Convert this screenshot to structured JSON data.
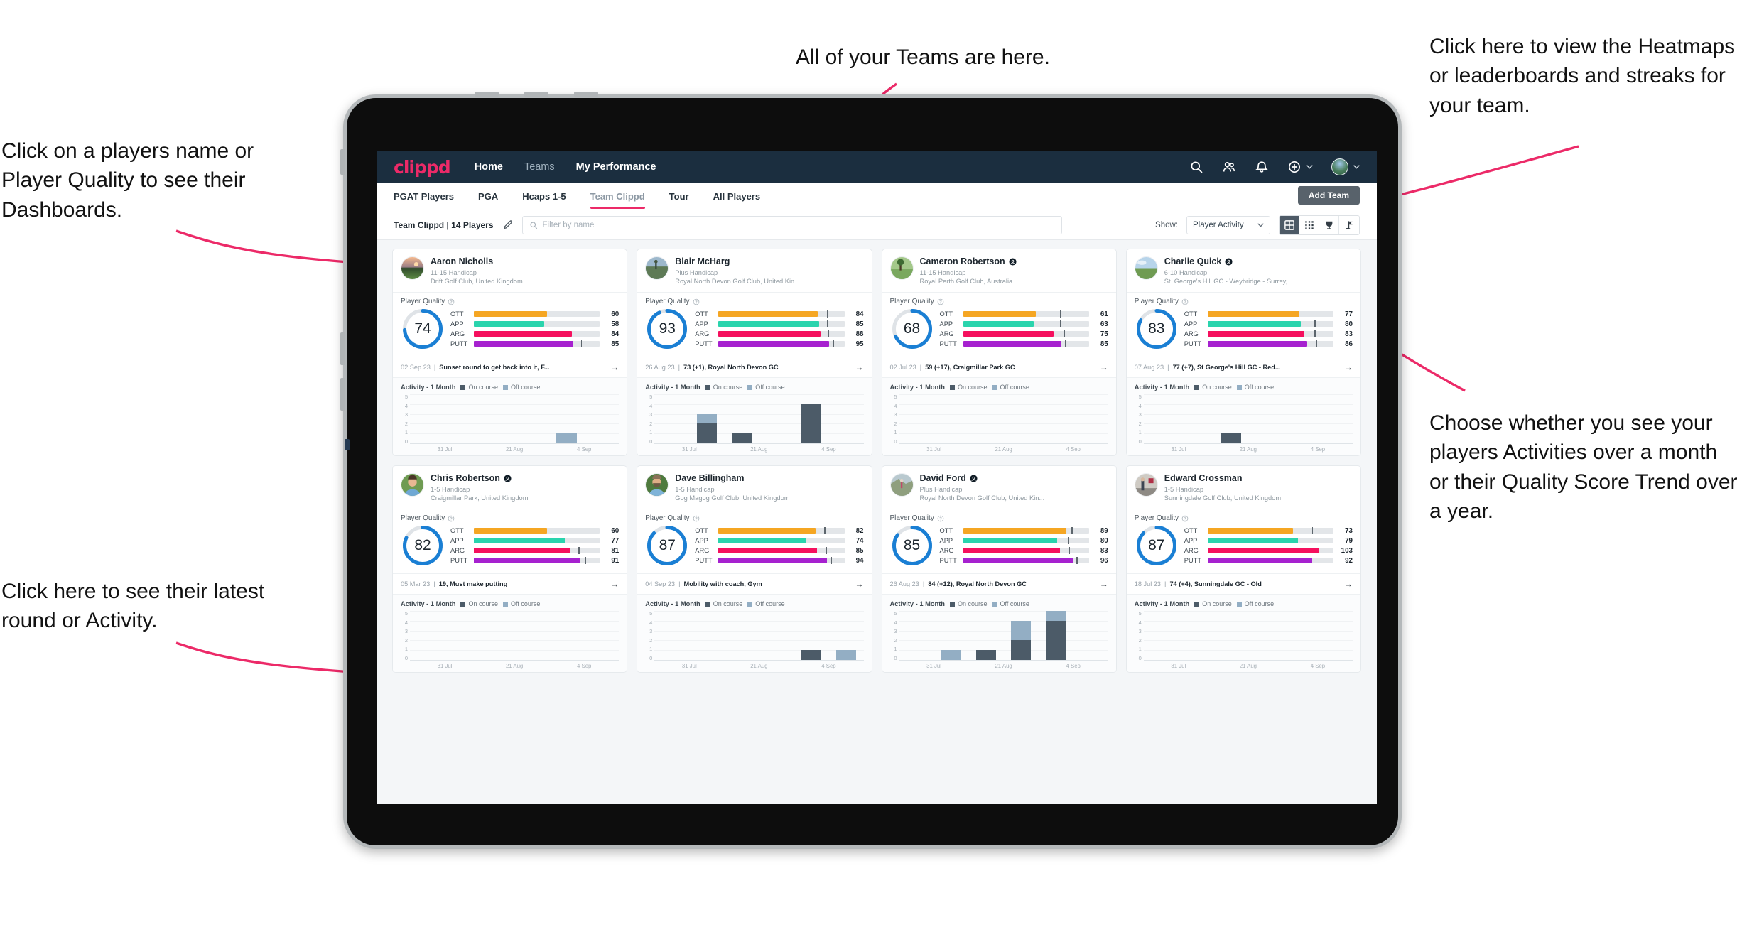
{
  "annotations": {
    "top_left": "Click on a players name or Player Quality to see their Dashboards.",
    "bottom_left": "Click here to see their latest round or Activity.",
    "top_center": "All of your Teams are here.",
    "top_right": "Click here to view the Heatmaps or leaderboards and streaks for your team.",
    "right": "Choose whether you see your players Activities over a month or their Quality Score Trend over a year.",
    "color": "#ec2a68"
  },
  "appbar": {
    "brand": "clippd",
    "nav": [
      {
        "label": "Home",
        "active": true
      },
      {
        "label": "Teams",
        "active": false
      },
      {
        "label": "My Performance",
        "active": true
      }
    ],
    "icons": [
      "search-icon",
      "people-icon",
      "bell-icon",
      "plus-circle-icon",
      "avatar"
    ]
  },
  "tabs": [
    {
      "label": "PGAT Players",
      "active": false
    },
    {
      "label": "PGA",
      "active": false
    },
    {
      "label": "Hcaps 1-5",
      "active": false
    },
    {
      "label": "Team Clippd",
      "active": true
    },
    {
      "label": "Tour",
      "active": false
    },
    {
      "label": "All Players",
      "active": false
    }
  ],
  "add_team_label": "Add Team",
  "toolbar": {
    "team_label": "Team Clippd | 14 Players",
    "edit_icon": "pencil-icon",
    "search_placeholder": "Filter by name",
    "search_value": "",
    "show_label": "Show:",
    "show_value": "Player Activity",
    "show_options": [
      "Player Activity",
      "Quality Score Trend"
    ],
    "views": [
      {
        "name": "card-view",
        "icon": "grid-large-icon",
        "active": true
      },
      {
        "name": "table-view",
        "icon": "grid-small-icon",
        "active": false
      },
      {
        "name": "leaderboard-view",
        "icon": "trophy-icon",
        "active": false
      },
      {
        "name": "heatmap-view",
        "icon": "flag-icon",
        "active": false
      }
    ]
  },
  "card_labels": {
    "player_quality": "Player Quality",
    "activity": "Activity - 1 Month",
    "legend_on": "On course",
    "legend_off": "Off course",
    "metrics": [
      "OTT",
      "APP",
      "ARG",
      "PUTT"
    ],
    "x_ticks": [
      "31 Jul",
      "21 Aug",
      "4 Sep"
    ],
    "y_ticks": [
      "5",
      "4",
      "3",
      "2",
      "1",
      "0"
    ]
  },
  "colors": {
    "ott": "#f5a623",
    "app": "#2ad4ad",
    "arg": "#f5105e",
    "putt": "#a621cf",
    "ring": "#1a7fd4",
    "ring_track": "#dfe3e7",
    "on_course": "#4c5b68",
    "off_course": "#93aec4",
    "brand": "#ec2a68",
    "header": "#1b2e3f"
  },
  "players": [
    {
      "name": "Aaron Nicholls",
      "verified": false,
      "handicap": "11-15 Handicap",
      "club": "Drift Golf Club, United Kingdom",
      "quality": 74,
      "metrics": [
        {
          "label": "OTT",
          "value": 60,
          "fill": 58,
          "tick": 76
        },
        {
          "label": "APP",
          "value": 58,
          "fill": 56,
          "tick": 76
        },
        {
          "label": "ARG",
          "value": 84,
          "fill": 78,
          "tick": 84
        },
        {
          "label": "PUTT",
          "value": 85,
          "fill": 79,
          "tick": 85
        }
      ],
      "round_date": "02 Sep 23",
      "round_text": "Sunset round to get back into it, F...",
      "activity": [
        {
          "on": 0,
          "off": 0
        },
        {
          "on": 0,
          "off": 0
        },
        {
          "on": 0,
          "off": 0
        },
        {
          "on": 0,
          "off": 0
        },
        {
          "on": 0,
          "off": 1
        },
        {
          "on": 0,
          "off": 0
        }
      ],
      "avatar": "sunset-course"
    },
    {
      "name": "Blair McHarg",
      "verified": false,
      "handicap": "Plus Handicap",
      "club": "Royal North Devon Golf Club, United Kin...",
      "quality": 93,
      "metrics": [
        {
          "label": "OTT",
          "value": 84,
          "fill": 79,
          "tick": 86
        },
        {
          "label": "APP",
          "value": 85,
          "fill": 80,
          "tick": 86
        },
        {
          "label": "ARG",
          "value": 88,
          "fill": 81,
          "tick": 87
        },
        {
          "label": "PUTT",
          "value": 95,
          "fill": 88,
          "tick": 91
        }
      ],
      "round_date": "26 Aug 23",
      "round_text": "73 (+1), Royal North Devon GC",
      "activity": [
        {
          "on": 0,
          "off": 0
        },
        {
          "on": 2,
          "off": 1
        },
        {
          "on": 1,
          "off": 0
        },
        {
          "on": 0,
          "off": 0
        },
        {
          "on": 4,
          "off": 0
        },
        {
          "on": 0,
          "off": 0
        }
      ],
      "avatar": "coastal-links"
    },
    {
      "name": "Cameron Robertson",
      "verified": true,
      "handicap": "11-15 Handicap",
      "club": "Royal Perth Golf Club, Australia",
      "quality": 68,
      "metrics": [
        {
          "label": "OTT",
          "value": 61,
          "fill": 58,
          "tick": 77
        },
        {
          "label": "APP",
          "value": 63,
          "fill": 56,
          "tick": 77
        },
        {
          "label": "ARG",
          "value": 75,
          "fill": 72,
          "tick": 80
        },
        {
          "label": "PUTT",
          "value": 85,
          "fill": 78,
          "tick": 81
        }
      ],
      "round_date": "02 Jul 23",
      "round_text": "59 (+17), Craigmillar Park GC",
      "activity": [
        {
          "on": 0,
          "off": 0
        },
        {
          "on": 0,
          "off": 0
        },
        {
          "on": 0,
          "off": 0
        },
        {
          "on": 0,
          "off": 0
        },
        {
          "on": 0,
          "off": 0
        },
        {
          "on": 0,
          "off": 0
        }
      ],
      "avatar": "fairway-tree"
    },
    {
      "name": "Charlie Quick",
      "verified": true,
      "handicap": "6-10 Handicap",
      "club": "St. George's Hill GC - Weybridge - Surrey, ...",
      "quality": 83,
      "metrics": [
        {
          "label": "OTT",
          "value": 77,
          "fill": 73,
          "tick": 84
        },
        {
          "label": "APP",
          "value": 80,
          "fill": 74,
          "tick": 85
        },
        {
          "label": "ARG",
          "value": 83,
          "fill": 77,
          "tick": 85
        },
        {
          "label": "PUTT",
          "value": 86,
          "fill": 79,
          "tick": 86
        }
      ],
      "round_date": "07 Aug 23",
      "round_text": "77 (+7), St George's Hill GC - Red...",
      "activity": [
        {
          "on": 0,
          "off": 0
        },
        {
          "on": 0,
          "off": 0
        },
        {
          "on": 1,
          "off": 0
        },
        {
          "on": 0,
          "off": 0
        },
        {
          "on": 0,
          "off": 0
        },
        {
          "on": 0,
          "off": 0
        }
      ],
      "avatar": "green-sky"
    },
    {
      "name": "Chris Robertson",
      "verified": true,
      "handicap": "1-5 Handicap",
      "club": "Craigmillar Park, United Kingdom",
      "quality": 82,
      "metrics": [
        {
          "label": "OTT",
          "value": 60,
          "fill": 58,
          "tick": 76
        },
        {
          "label": "APP",
          "value": 77,
          "fill": 72,
          "tick": 80
        },
        {
          "label": "ARG",
          "value": 81,
          "fill": 76,
          "tick": 83
        },
        {
          "label": "PUTT",
          "value": 91,
          "fill": 84,
          "tick": 88
        }
      ],
      "round_date": "05 Mar 23",
      "round_text": "19, Must make putting",
      "activity": [
        {
          "on": 0,
          "off": 0
        },
        {
          "on": 0,
          "off": 0
        },
        {
          "on": 0,
          "off": 0
        },
        {
          "on": 0,
          "off": 0
        },
        {
          "on": 0,
          "off": 0
        },
        {
          "on": 0,
          "off": 0
        }
      ],
      "avatar": "portrait-blue"
    },
    {
      "name": "Dave Billingham",
      "verified": false,
      "handicap": "1-5 Handicap",
      "club": "Gog Magog Golf Club, United Kingdom",
      "quality": 87,
      "metrics": [
        {
          "label": "OTT",
          "value": 82,
          "fill": 77,
          "tick": 84
        },
        {
          "label": "APP",
          "value": 74,
          "fill": 70,
          "tick": 81
        },
        {
          "label": "ARG",
          "value": 85,
          "fill": 78,
          "tick": 85
        },
        {
          "label": "PUTT",
          "value": 94,
          "fill": 86,
          "tick": 89
        }
      ],
      "round_date": "04 Sep 23",
      "round_text": "Mobility with coach, Gym",
      "activity": [
        {
          "on": 0,
          "off": 0
        },
        {
          "on": 0,
          "off": 0
        },
        {
          "on": 0,
          "off": 0
        },
        {
          "on": 0,
          "off": 0
        },
        {
          "on": 1,
          "off": 0
        },
        {
          "on": 0,
          "off": 1
        }
      ],
      "avatar": "portrait-beard"
    },
    {
      "name": "David Ford",
      "verified": true,
      "handicap": "Plus Handicap",
      "club": "Royal North Devon Golf Club, United Kin...",
      "quality": 85,
      "metrics": [
        {
          "label": "OTT",
          "value": 89,
          "fill": 82,
          "tick": 86
        },
        {
          "label": "APP",
          "value": 80,
          "fill": 75,
          "tick": 83
        },
        {
          "label": "ARG",
          "value": 83,
          "fill": 77,
          "tick": 84
        },
        {
          "label": "PUTT",
          "value": 96,
          "fill": 88,
          "tick": 90
        }
      ],
      "round_date": "26 Aug 23",
      "round_text": "84 (+12), Royal North Devon GC",
      "activity": [
        {
          "on": 0,
          "off": 0
        },
        {
          "on": 0,
          "off": 1
        },
        {
          "on": 1,
          "off": 0
        },
        {
          "on": 2,
          "off": 2
        },
        {
          "on": 4,
          "off": 1
        },
        {
          "on": 0,
          "off": 0
        }
      ],
      "avatar": "hillside-walk"
    },
    {
      "name": "Edward Crossman",
      "verified": false,
      "handicap": "1-5 Handicap",
      "club": "Sunningdale Golf Club, United Kingdom",
      "quality": 87,
      "metrics": [
        {
          "label": "OTT",
          "value": 73,
          "fill": 68,
          "tick": 83
        },
        {
          "label": "APP",
          "value": 79,
          "fill": 72,
          "tick": 84
        },
        {
          "label": "ARG",
          "value": 103,
          "fill": 88,
          "tick": 92
        },
        {
          "label": "PUTT",
          "value": 92,
          "fill": 83,
          "tick": 88
        }
      ],
      "round_date": "18 Jul 23",
      "round_text": "74 (+4), Sunningdale GC - Old",
      "activity": [
        {
          "on": 0,
          "off": 0
        },
        {
          "on": 0,
          "off": 0
        },
        {
          "on": 0,
          "off": 0
        },
        {
          "on": 0,
          "off": 0
        },
        {
          "on": 0,
          "off": 0
        },
        {
          "on": 0,
          "off": 0
        }
      ],
      "avatar": "indoor-range"
    }
  ]
}
